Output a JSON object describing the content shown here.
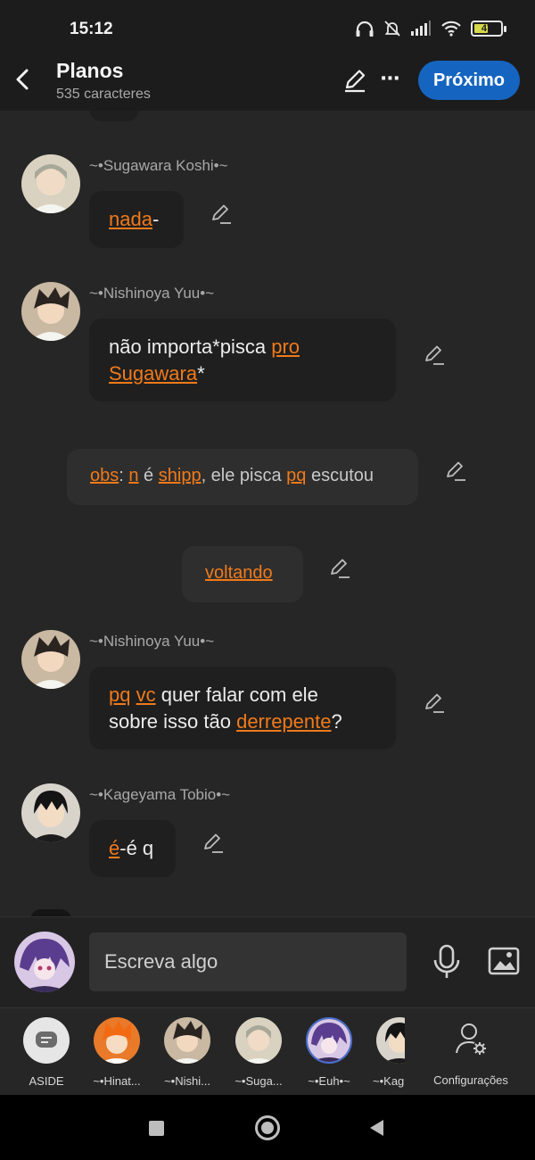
{
  "status_bar": {
    "time": "15:12",
    "battery": "47"
  },
  "header": {
    "title": "Planos",
    "subtitle": "535 caracteres",
    "next_label": "Próximo"
  },
  "messages": {
    "m1": {
      "name": "~•Sugawara Koshi•~",
      "link1": "nada",
      "after": "-"
    },
    "m2": {
      "name": "~•Nishinoya Yuu•~",
      "pre": "não importa*pisca ",
      "link1": "pro",
      "link2": "Sugawara",
      "after": "*"
    },
    "m3": {
      "link_obs": "obs",
      "sep1": ": ",
      "link_n": "n",
      "t1": " é ",
      "link_shipp": "shipp",
      "t2": ", ele pisca ",
      "link_pq": "pq",
      "t3": " escutou"
    },
    "m4": {
      "link": "voltando"
    },
    "m5": {
      "name": "~•Nishinoya Yuu•~",
      "link_pq": "pq",
      "sp": " ",
      "link_vc": "vc",
      "t1": " quer falar com ele",
      "t2": "sobre isso tão ",
      "link_derr": "derrepente",
      "after": "?"
    },
    "m6": {
      "name": "~•Kageyama Tobio•~",
      "link": "é",
      "after": "-é q"
    }
  },
  "input": {
    "placeholder": "Escreva algo"
  },
  "characters": [
    {
      "label": "ASIDE"
    },
    {
      "label": "~•Hinat..."
    },
    {
      "label": "~•Nishi..."
    },
    {
      "label": "~•Suga..."
    },
    {
      "label": "~•Euh•~"
    },
    {
      "label": "~•Kag"
    }
  ],
  "settings_label": "Configurações",
  "colors": {
    "link": "#f07a1a",
    "primary": "#1565c0",
    "background": "#262626"
  }
}
